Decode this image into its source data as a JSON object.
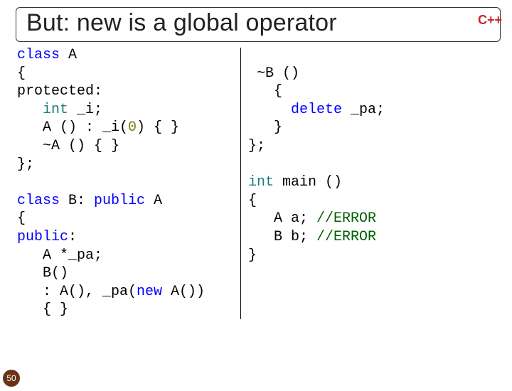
{
  "lang_tag": "C++",
  "title": "But: new is a global operator",
  "slide_number": "50",
  "code_left": {
    "l01a": "class",
    "l01b": " A",
    "l02": "{",
    "l03": "protected:",
    "l04a": "   ",
    "l04b": "int",
    "l04c": " _i;",
    "l05a": "   A () : _i(",
    "l05b": "0",
    "l05c": ") { }",
    "l06": "   ~A () { }",
    "l07": "};",
    "l08": "",
    "l09a": "class",
    "l09b": " B: ",
    "l09c": "public",
    "l09d": " A",
    "l10": "{",
    "l11a": "public",
    "l11b": ":",
    "l12": "   A *_pa;",
    "l13": "   B()",
    "l14a": "   : A(), _pa(",
    "l14b": "new",
    "l14c": " A())",
    "l15": "   { }"
  },
  "code_right": {
    "r00": "",
    "r01": " ~B ()",
    "r02": "   {",
    "r03a": "     ",
    "r03b": "delete",
    "r03c": " _pa;",
    "r04": "   }",
    "r05": "};",
    "r06": "",
    "r07a": "int",
    "r07b": " main ()",
    "r08": "{",
    "r09a": "   A a; ",
    "r09b": "//ERROR",
    "r10a": "   B b; ",
    "r10b": "//ERROR",
    "r11": "}"
  }
}
